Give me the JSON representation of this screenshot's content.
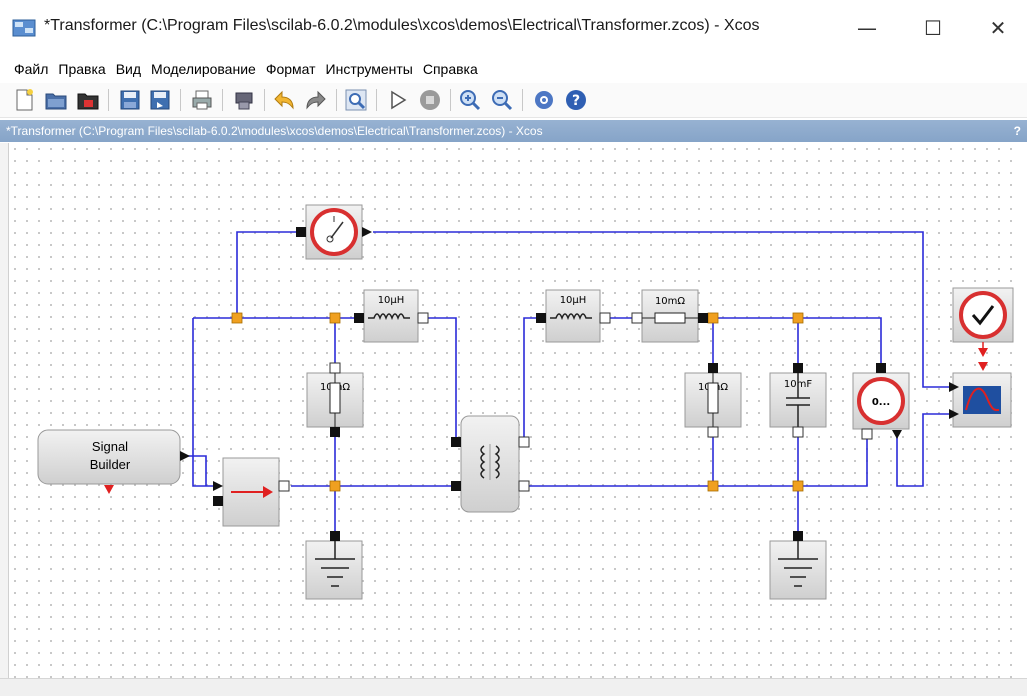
{
  "window": {
    "title": "*Transformer (C:\\Program Files\\scilab-6.0.2\\modules\\xcos\\demos\\Electrical\\Transformer.zcos) - Xcos",
    "controls": {
      "minimize": "—",
      "maximize": "☐",
      "close": "✕"
    }
  },
  "menu": [
    "Файл",
    "Правка",
    "Вид",
    "Моделирование",
    "Формат",
    "Инструменты",
    "Справка"
  ],
  "toolbar": {
    "icons": [
      "new-diagram-icon",
      "open-icon",
      "open-in-scilab-icon",
      "save-icon",
      "save-as-icon",
      "print-icon",
      "export-icon",
      "undo-icon",
      "redo-icon",
      "fit-diagram-icon",
      "start-icon",
      "stop-icon",
      "zoom-in-icon",
      "zoom-out-icon",
      "palette-browser-icon",
      "help-icon"
    ]
  },
  "tab": {
    "title": "*Transformer (C:\\Program Files\\scilab-6.0.2\\modules\\xcos\\demos\\Electrical\\Transformer.zcos) - Xcos",
    "help": "?"
  },
  "diagram": {
    "blocks": {
      "signal_builder": {
        "line1": "Signal",
        "line2": "Builder"
      },
      "inductor1": "10µH",
      "inductor2": "10µH",
      "resistor_top": "10mΩ",
      "resistor_left": "10mΩ",
      "resistor_right": "10mΩ",
      "capacitor": "10mF",
      "voltmeter": "0..."
    },
    "colors": {
      "wire": "#2b2bd8",
      "node": "#f0a020",
      "port_in": "#111111",
      "block_gray": "#d8d8d8",
      "red": "#e02020"
    }
  }
}
